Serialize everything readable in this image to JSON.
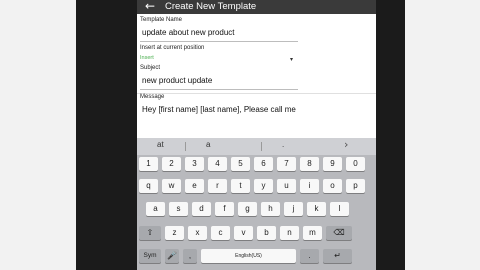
{
  "app": {
    "title": "Create New Template",
    "back_icon": "arrow-left-icon"
  },
  "form": {
    "template_name_label": "Template Name",
    "template_name_value": "update about new product",
    "insert_label": "Insert at current position",
    "insert_value": "Insert",
    "subject_label": "Subject",
    "subject_value": "new product update",
    "message_label": "Message",
    "message_value": "Hey [first name] [last name], Please call me"
  },
  "keyboard": {
    "suggestions": [
      "at",
      "a",
      "."
    ],
    "row_numbers": [
      "1",
      "2",
      "3",
      "4",
      "5",
      "6",
      "7",
      "8",
      "9",
      "0"
    ],
    "row_q": [
      "q",
      "w",
      "e",
      "r",
      "t",
      "y",
      "u",
      "i",
      "o",
      "p"
    ],
    "row_a": [
      "a",
      "s",
      "d",
      "f",
      "g",
      "h",
      "j",
      "k",
      "l"
    ],
    "row_z": [
      "z",
      "x",
      "c",
      "v",
      "b",
      "n",
      "m"
    ],
    "sym_label": "Sym",
    "space_label": "English(US)",
    "comma_label": ",",
    "period_label": ".",
    "icons": {
      "shift": "shift-icon",
      "backspace": "backspace-icon",
      "mic": "microphone-icon",
      "enter": "enter-icon",
      "chevron": "chevron-right-icon"
    }
  },
  "colors": {
    "appbar": "#3a3a3a",
    "insert_hint": "#4caf50",
    "keyboard_bg": "#b8b9bd"
  }
}
